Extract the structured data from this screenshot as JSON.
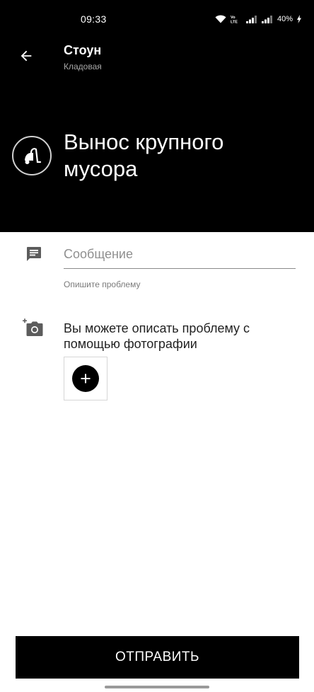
{
  "status_bar": {
    "time": "09:33",
    "battery": "40%",
    "network_label": "Vo LTE"
  },
  "header": {
    "title": "Стоун",
    "subtitle": "Кладовая",
    "service_title": "Вынос крупного мусора",
    "service_icon": "vacuum-cleaner-icon"
  },
  "form": {
    "message_placeholder": "Сообщение",
    "message_value": "",
    "helper": "Опишите проблему",
    "photo_text": "Вы можете описать проблему с помощью фотографии"
  },
  "submit_label": "ОТПРАВИТЬ",
  "colors": {
    "header_bg": "#000000",
    "button_bg": "#000000",
    "text_primary": "#222222"
  }
}
